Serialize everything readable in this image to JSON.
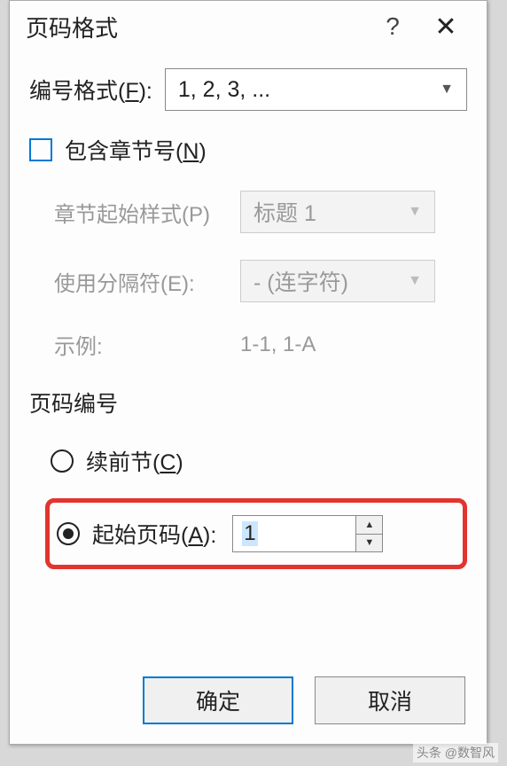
{
  "title": "页码格式",
  "help": "?",
  "close": "✕",
  "format_row": {
    "label_pre": "编号格式(",
    "label_u": "F",
    "label_post": "):",
    "value": "1, 2, 3, ..."
  },
  "include_chapter": {
    "label_pre": "包含章节号(",
    "label_u": "N",
    "label_post": ")"
  },
  "chapter": {
    "start_label": "章节起始样式(P)",
    "start_value": "标题 1",
    "sep_label": "使用分隔符(E):",
    "sep_value": "-   (连字符)",
    "example_label": "示例:",
    "example_value": "1-1, 1-A"
  },
  "page_num_section": "页码编号",
  "radio_continue": {
    "label_pre": "续前节(",
    "label_u": "C",
    "label_post": ")"
  },
  "radio_start": {
    "label_pre": "起始页码(",
    "label_u": "A",
    "label_post": "):",
    "value": "1"
  },
  "buttons": {
    "ok": "确定",
    "cancel": "取消"
  },
  "watermark": "头条 @数智风"
}
